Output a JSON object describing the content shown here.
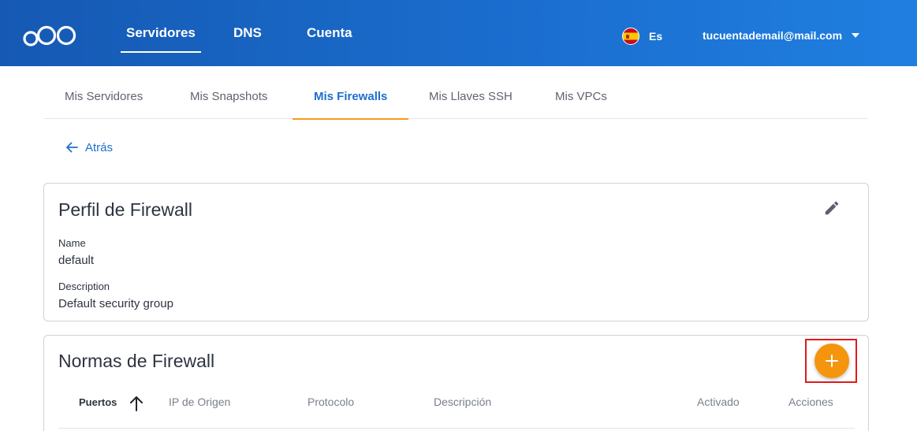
{
  "header": {
    "nav": [
      {
        "label": "Servidores",
        "active": true
      },
      {
        "label": "DNS",
        "active": false
      },
      {
        "label": "Cuenta",
        "active": false
      }
    ],
    "language": "Es",
    "account_email": "tucuentademail@mail.com"
  },
  "tabs": [
    {
      "label": "Mis Servidores",
      "active": false
    },
    {
      "label": "Mis Snapshots",
      "active": false
    },
    {
      "label": "Mis Firewalls",
      "active": true
    },
    {
      "label": "Mis Llaves SSH",
      "active": false
    },
    {
      "label": "Mis VPCs",
      "active": false
    }
  ],
  "back_label": "Atrás",
  "profile": {
    "title": "Perfil de Firewall",
    "name_label": "Name",
    "name_value": "default",
    "description_label": "Description",
    "description_value": "Default security group"
  },
  "rules": {
    "title": "Normas de Firewall",
    "columns": [
      "Puertos",
      "IP de Origen",
      "Protocolo",
      "Descripción",
      "Activado",
      "Acciones"
    ]
  },
  "colors": {
    "header_blue": "#1b6fd0",
    "active_tab_underline": "#f59a1b",
    "fab_orange": "#f5950e",
    "highlight_red": "#e01b1b"
  },
  "icons": {
    "logo": "three-circles-logo",
    "flag": "spain-flag-icon",
    "account_dropdown": "caret-down-icon",
    "back": "arrow-left-icon",
    "edit": "pencil-icon",
    "add": "plus-icon",
    "sort": "arrow-up-icon"
  }
}
